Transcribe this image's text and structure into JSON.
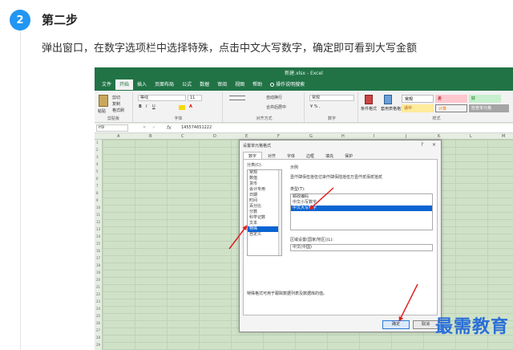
{
  "step": {
    "number": "2",
    "title": "第二步",
    "description": "弹出窗口，在数字选项栏中选择特殊，点击中文大写数字，确定即可看到大写金额"
  },
  "excel": {
    "doc_title": "新建.xlsx - Excel",
    "tabs": [
      "文件",
      "开始",
      "插入",
      "页面布局",
      "公式",
      "数据",
      "审阅",
      "视图",
      "帮助"
    ],
    "active_tab": "开始",
    "tell_me": "操作说明搜索",
    "ribbon": {
      "clipboard": {
        "paste": "粘贴",
        "cut": "剪切",
        "copy": "复制",
        "format_painter": "格式刷",
        "label": "剪贴板"
      },
      "font": {
        "name": "等线",
        "size": "11",
        "label": "字体"
      },
      "align": {
        "wrap": "自动换行",
        "merge": "合并后居中",
        "label": "对齐方式"
      },
      "number": {
        "format": "常规",
        "label": "数字"
      },
      "styles": {
        "cond": "条件格式",
        "table": "套用表格格式",
        "cells": [
          "常规",
          "差",
          "好",
          "适中",
          "计算",
          "检查单元格"
        ],
        "label": "样式"
      }
    },
    "name_box": "H9",
    "formula": "145574651222",
    "columns": [
      "A",
      "B",
      "C",
      "D",
      "E",
      "F",
      "G",
      "H",
      "I",
      "J",
      "K",
      "L",
      "M"
    ],
    "rows": [
      "1",
      "2",
      "3",
      "4",
      "5",
      "6",
      "7",
      "8",
      "9",
      "10",
      "11",
      "12",
      "13",
      "14",
      "15",
      "16",
      "17",
      "18",
      "19",
      "20",
      "21",
      "22",
      "23",
      "24",
      "25",
      "26",
      "27",
      "28",
      "29"
    ]
  },
  "dialog": {
    "title": "设置单元格格式",
    "help": "?",
    "close": "×",
    "tabs": [
      "数字",
      "对齐",
      "字体",
      "边框",
      "填充",
      "保护"
    ],
    "active_tab": "数字",
    "category_label": "分类(C):",
    "categories": [
      "常规",
      "数值",
      "货币",
      "会计专用",
      "日期",
      "时间",
      "百分比",
      "分数",
      "科学记数",
      "文本",
      "特殊",
      "自定义"
    ],
    "selected_category": "特殊",
    "sample_label": "示例",
    "sample_value": "壹仟肆佰伍拾伍亿柒仟肆佰陆拾伍万壹仟贰佰贰拾贰",
    "type_label": "类型(T):",
    "types": [
      "邮政编码",
      "中文小写数字",
      "中文大写数字"
    ],
    "selected_type": "中文大写数字",
    "locale_label": "区域设置(国家/地区)(L):",
    "locale_value": "中文(中国)",
    "description": "特殊格式可用于跟踪数据列表及数据库的值。",
    "ok": "确定",
    "cancel": "取消"
  },
  "watermark": "最需教育"
}
